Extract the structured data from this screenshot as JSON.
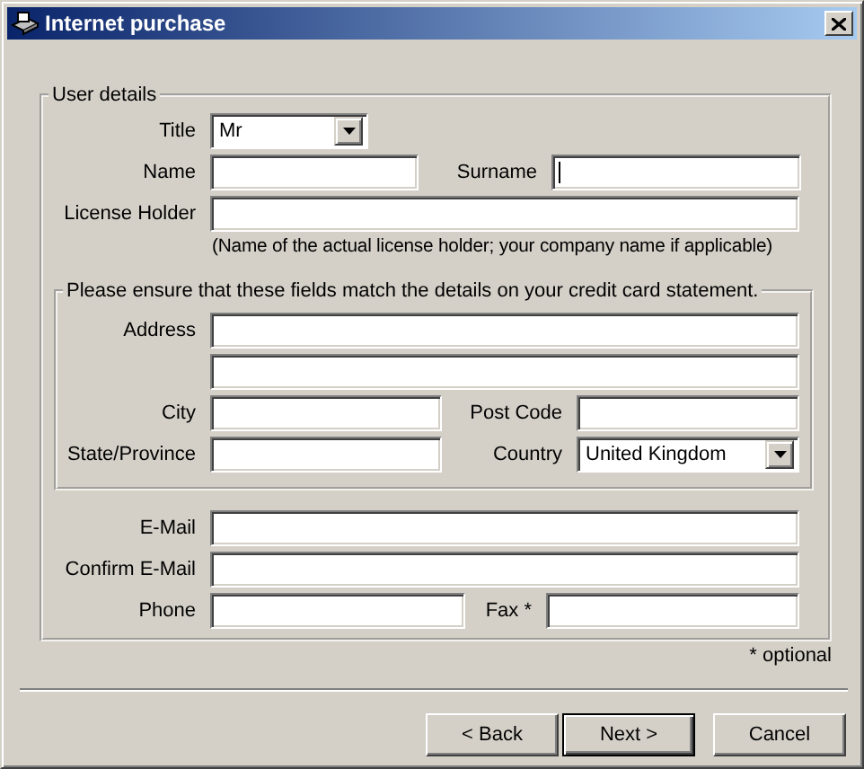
{
  "window": {
    "title": "Internet purchase"
  },
  "user_details": {
    "legend": "User details",
    "title": {
      "label": "Title",
      "value": "Mr"
    },
    "name": {
      "label": "Name",
      "focused": false
    },
    "surname": {
      "label": "Surname",
      "focused": true
    },
    "license_holder": {
      "label": "License Holder",
      "focused": false,
      "note": "(Name of the actual license holder; your company name if applicable)"
    },
    "card_details": {
      "legend": "Please ensure that these fields match the details on your credit card statement.",
      "address": {
        "label": "Address",
        "lines": [
          {
            "focused": false
          },
          {
            "focused": false
          }
        ]
      },
      "city": {
        "label": "City",
        "focused": false
      },
      "post_code": {
        "label": "Post Code",
        "focused": false
      },
      "state": {
        "label": "State/Province",
        "focused": false
      },
      "country": {
        "label": "Country",
        "value": "United Kingdom"
      }
    },
    "email": {
      "label": "E-Mail",
      "focused": false
    },
    "confirm_email": {
      "label": "Confirm E-Mail",
      "focused": false
    },
    "phone": {
      "label": "Phone",
      "focused": false
    },
    "fax": {
      "label": "Fax *",
      "focused": false
    }
  },
  "optional_note": "* optional",
  "buttons": [
    {
      "label": "< Back",
      "default": false
    },
    {
      "label": "Next >",
      "default": true
    },
    {
      "label": "Cancel",
      "default": false
    }
  ]
}
